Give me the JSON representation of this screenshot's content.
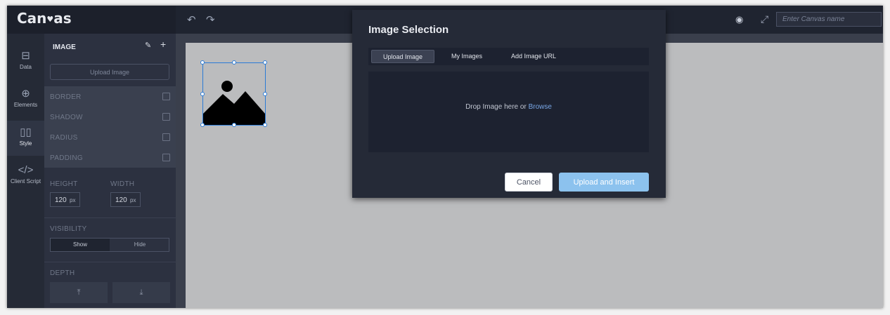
{
  "app": {
    "logo_text_before": "Can",
    "logo_text_after": "as",
    "canvas_name_placeholder": "Enter Canvas name"
  },
  "toolbar": {
    "undo_icon": "undo-icon",
    "redo_icon": "redo-icon",
    "preview_icon": "eye-icon",
    "fullscreen_icon": "expand-icon"
  },
  "rail": {
    "items": [
      {
        "label": "Data",
        "icon": "data-icon"
      },
      {
        "label": "Elements",
        "icon": "plus-circle-icon"
      },
      {
        "label": "Style",
        "icon": "style-icon",
        "active": true
      },
      {
        "label": "Client Script",
        "icon": "code-icon"
      }
    ]
  },
  "properties": {
    "title": "IMAGE",
    "upload_label": "Upload Image",
    "toggles": [
      "BORDER",
      "SHADOW",
      "RADIUS",
      "PADDING"
    ],
    "height_label": "HEIGHT",
    "width_label": "WIDTH",
    "height_value": "120",
    "width_value": "120",
    "unit": "px",
    "visibility_label": "VISIBILITY",
    "visibility_show": "Show",
    "visibility_hide": "Hide",
    "depth_label": "DEPTH",
    "depth_forward_glyph": "⤒",
    "depth_backward_glyph": "⤓"
  },
  "modal": {
    "title": "Image Selection",
    "tabs": [
      {
        "label": "Upload Image",
        "active": true
      },
      {
        "label": "My Images",
        "active": false
      },
      {
        "label": "Add Image URL",
        "active": false
      }
    ],
    "drop_text": "Drop Image here or ",
    "browse_link": "Browse",
    "cancel_label": "Cancel",
    "insert_label": "Upload and Insert"
  },
  "colors": {
    "accent": "#8cc2ee",
    "link": "#79a7e6",
    "selection": "#2b7bd6"
  }
}
